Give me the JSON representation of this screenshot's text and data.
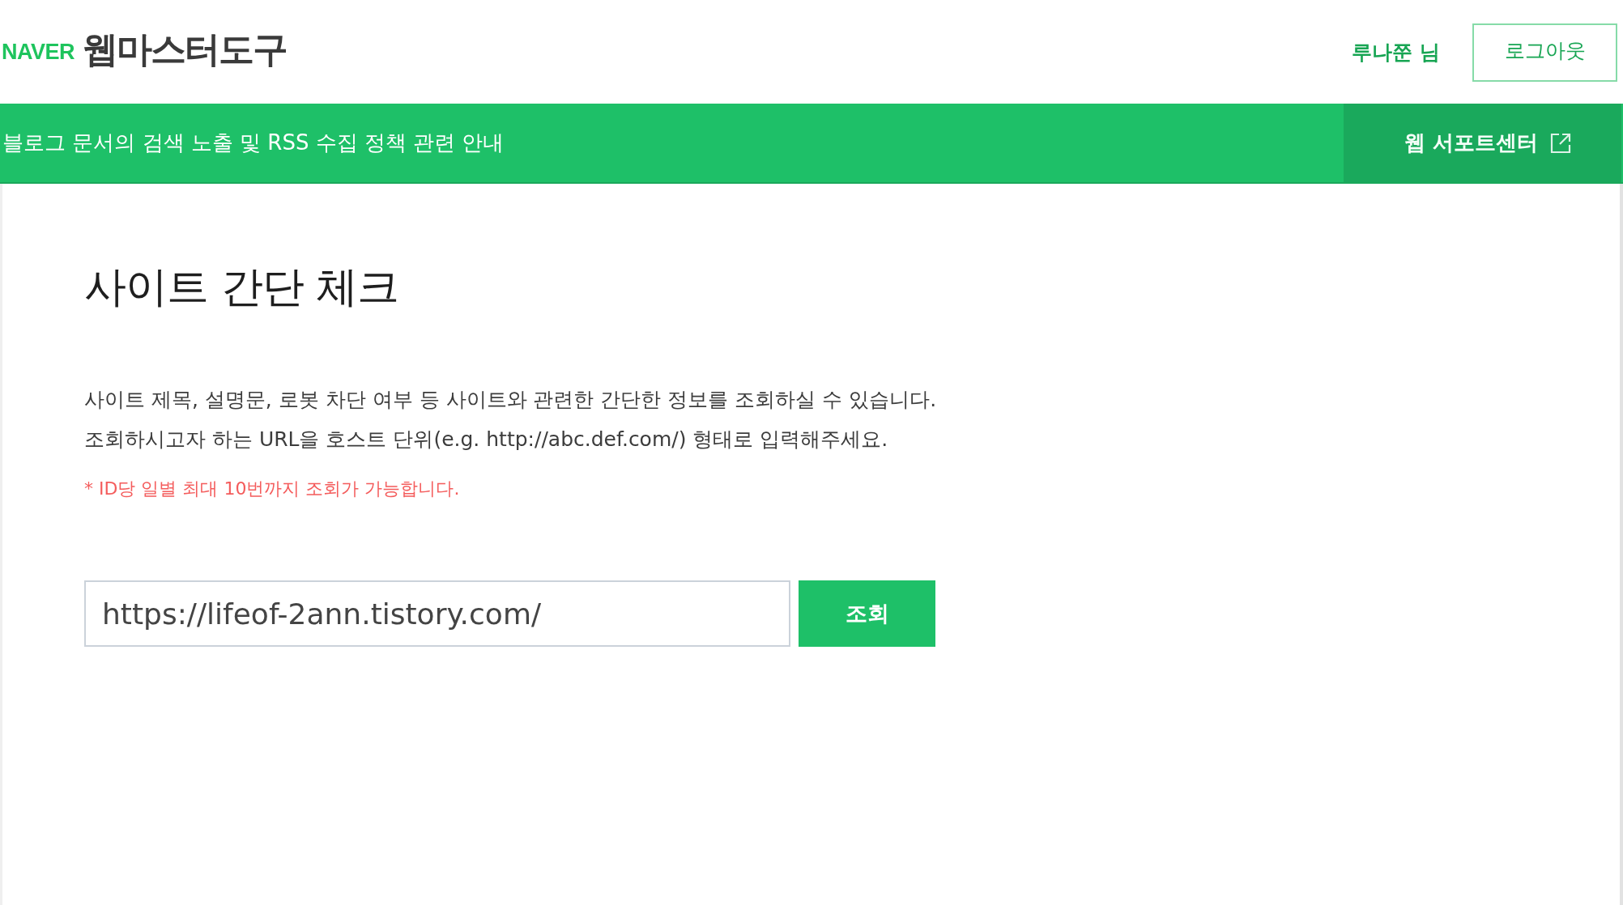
{
  "header": {
    "brand": "NAVER",
    "title": "웹마스터도구",
    "user": "루나쭌 님",
    "logout_button": "로그아웃"
  },
  "notice_bar": {
    "text": "블로그 문서의 검색 노출 및 RSS 수집 정책 관련 안내",
    "support_link": "웹 서포트센터"
  },
  "page": {
    "title": "사이트 간단 체크",
    "description": [
      "사이트 제목, 설명문, 로봇 차단 여부 등 사이트와 관련한 간단한 정보를 조회하실 수 있습니다.",
      "조회하시고자 하는 URL을 호스트 단위(e.g. http://abc.def.com/) 형태로 입력해주세요."
    ],
    "note": "* ID당 일별 최대 10번까지 조회가 가능합니다.",
    "url_field": {
      "value": "https://lifeof-2ann.tistory.com/"
    },
    "submit_button": "조회"
  }
}
